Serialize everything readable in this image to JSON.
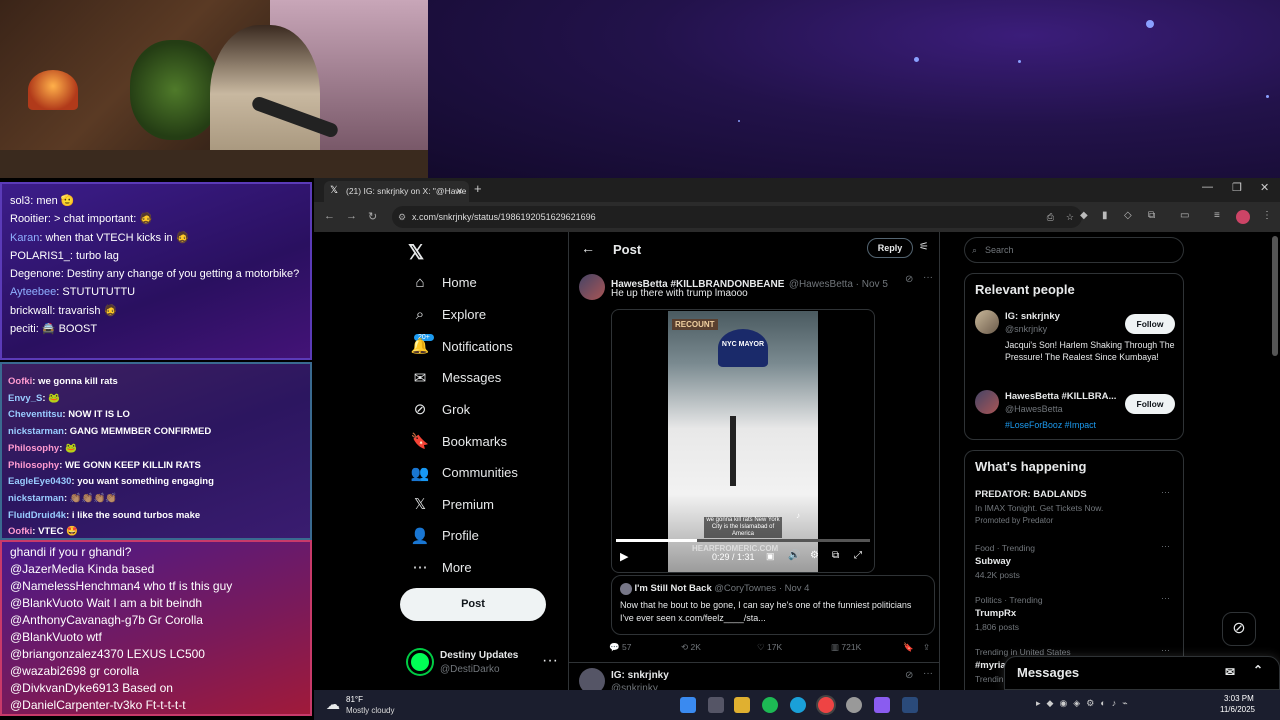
{
  "chat1": [
    {
      "user": "sol3",
      "msg": "men 🫡"
    },
    {
      "user": "Rooitier",
      "msg": "> chat important: 🧔"
    },
    {
      "user": "Karan",
      "msg": "when that VTECH kicks in 🧔"
    },
    {
      "user": "POLARIS1_",
      "msg": "turbo lag"
    },
    {
      "user": "Degenone",
      "msg": "Destiny any change of you getting a motorbike?"
    },
    {
      "user": "Ayteebee",
      "msg": "STUTUTUTTU"
    },
    {
      "user": "brickwall",
      "msg": "travarish 🧔"
    },
    {
      "user": "peciti",
      "msg": "🚔 BOOST"
    }
  ],
  "chat2": [
    {
      "user": "Oofki",
      "msg": "we gonna kill rats"
    },
    {
      "user": "Envy_S",
      "msg": "🐸"
    },
    {
      "user": "Cheventitsu",
      "msg": "NOW IT IS LO"
    },
    {
      "user": "nickstarman",
      "msg": "GANG MEMMBER CONFIRMED"
    },
    {
      "user": "Philosophy",
      "msg": "🐸"
    },
    {
      "user": "Philosophy",
      "msg": "WE GONN KEEP KILLIN RATS"
    },
    {
      "user": "EagleEye0430",
      "msg": "you want something engaging"
    },
    {
      "user": "nickstarman",
      "msg": "👏🏽👏🏽👏🏽👏🏽"
    },
    {
      "user": "FluidDruid4k",
      "msg": "i like the sound turbos make"
    },
    {
      "user": "Oofki",
      "msg": "VTEC 🤩"
    }
  ],
  "chat3": [
    "ghandi if you r ghandi?",
    "@JazerMedia Kinda based",
    "@NamelessHenchman4 who tf is this guy",
    "@BlankVuoto Wait I am a bit beindh",
    "@AnthonyCavanagh-g7b Gr Corolla",
    "@BlankVuoto wtf",
    "@briangonzalez4370 LEXUS LC500",
    "@wazabi2698 gr corolla",
    "@DivkvanDyke6913 Based on",
    "@DanielCarpenter-tv3ko Ft-t-t-t-t"
  ],
  "browser": {
    "tab_title": "(21) IG: snkrjnky on X: \"@Hawe",
    "url": "x.com/snkrjnky/status/1986192051629621696"
  },
  "nav": {
    "items": [
      {
        "label": "Home",
        "icon": "home-icon"
      },
      {
        "label": "Explore",
        "icon": "search-icon"
      },
      {
        "label": "Notifications",
        "icon": "bell-icon"
      },
      {
        "label": "Messages",
        "icon": "mail-icon"
      },
      {
        "label": "Grok",
        "icon": "grok-icon"
      },
      {
        "label": "Bookmarks",
        "icon": "bookmark-icon"
      },
      {
        "label": "Communities",
        "icon": "people-icon"
      },
      {
        "label": "Premium",
        "icon": "x-icon"
      },
      {
        "label": "Profile",
        "icon": "person-icon"
      },
      {
        "label": "More",
        "icon": "more-icon"
      }
    ],
    "notif_badge": "20+",
    "post_label": "Post",
    "account_name": "Destiny Updates",
    "account_handle": "@DestiDarko"
  },
  "main": {
    "title": "Post",
    "reply_label": "Reply",
    "tweet": {
      "name": "HawesBetta #KILLBRANDONBEANE",
      "handle": "@HawesBetta · Nov 5",
      "text": "He up there with trump lmaooo"
    },
    "video": {
      "sign": "RECOUNT",
      "hat": "NYC MAYOR",
      "caption": "we gonna kill rats New York City is the Islamabad of America",
      "watermark": "HEARFROMERIC.COM",
      "time": "0:29 / 1:31",
      "progress": 0.32
    },
    "quote": {
      "name": "I'm Still Not Back",
      "handle": "@CoryTownes · Nov 4",
      "text": "Now that he bout to be gone, I can say he's one of the funniest politicians I've ever seen x.com/feelz____/sta..."
    },
    "stats": {
      "replies": "57",
      "reposts": "2K",
      "likes": "17K",
      "views": "721K"
    },
    "next_tweet": {
      "name": "IG: snkrjnky",
      "handle": "@snkrjnky"
    }
  },
  "sidebar": {
    "search_placeholder": "Search",
    "relevant_title": "Relevant people",
    "people": [
      {
        "name": "IG: snkrjnky",
        "handle": "@snkrjnky",
        "bio": "Jacqui's Son! Harlem Shaking Through The Pressure! The Realest Since Kumbaya!",
        "follow": "Follow"
      },
      {
        "name": "HawesBetta #KILLBRA...",
        "handle": "@HawesBetta",
        "bio": "#LoseForBooz #Impact",
        "follow": "Follow"
      }
    ],
    "happening_title": "What's happening",
    "trends": [
      {
        "meta": "",
        "title": "PREDATOR: BADLANDS",
        "sub": "In IMAX Tonight. Get Tickets Now.",
        "extra": "Promoted by Predator"
      },
      {
        "meta": "Food · Trending",
        "title": "Subway",
        "sub": "44.2K posts",
        "extra": ""
      },
      {
        "meta": "Politics · Trending",
        "title": "TrumpRx",
        "sub": "1,806 posts",
        "extra": ""
      },
      {
        "meta": "Trending in United States",
        "title": "#myria",
        "sub": "Trendin",
        "extra": ""
      }
    ],
    "messages_label": "Messages"
  },
  "taskbar": {
    "temp": "81°F",
    "weather": "Mostly cloudy",
    "time": "3:03 PM",
    "date": "11/6/2025"
  }
}
